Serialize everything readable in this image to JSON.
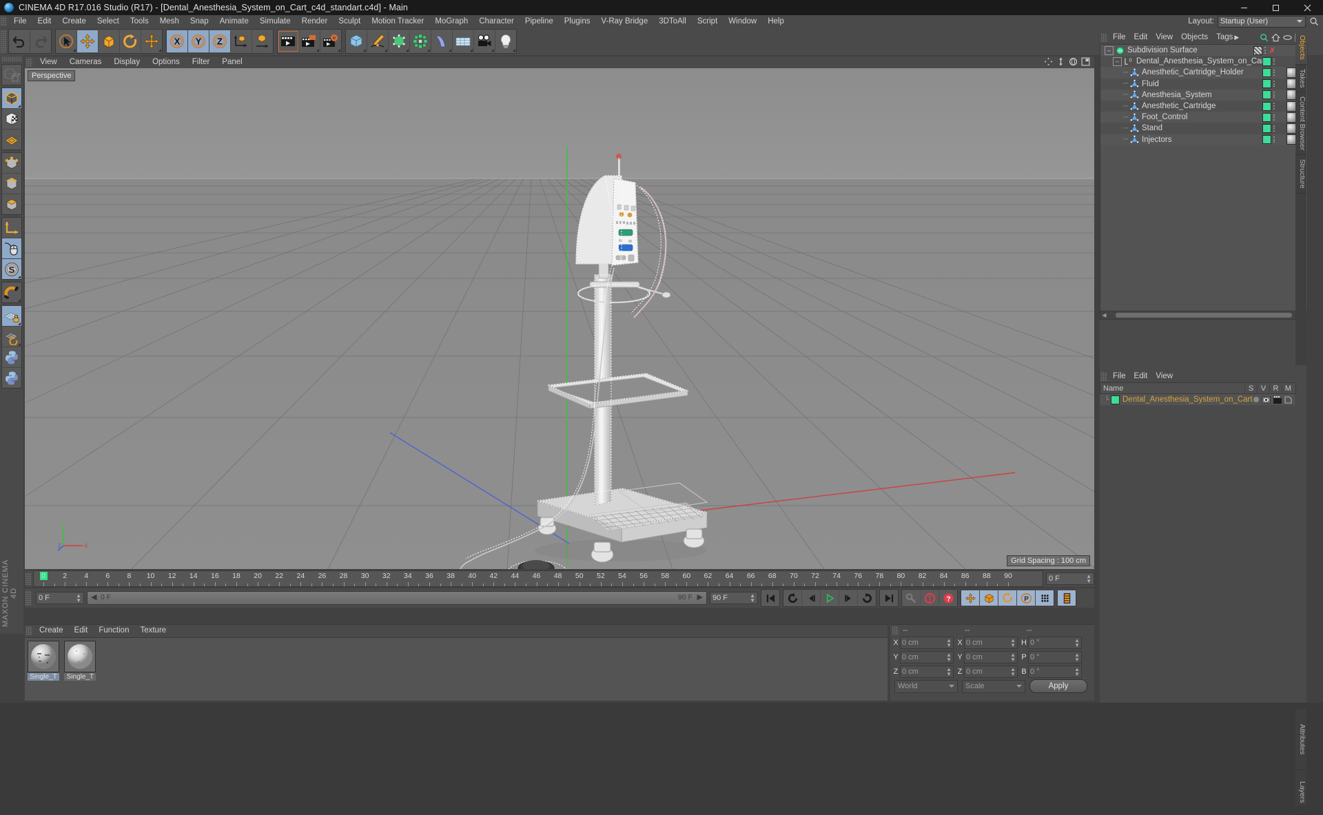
{
  "app": {
    "title": "CINEMA 4D R17.016 Studio (R17) - [Dental_Anesthesia_System_on_Cart_c4d_standart.c4d] - Main",
    "logo_icon": "cinema4d-logo-icon",
    "window_buttons": [
      "minimize",
      "maximize",
      "close"
    ]
  },
  "menubar": {
    "items": [
      "File",
      "Edit",
      "Create",
      "Select",
      "Tools",
      "Mesh",
      "Snap",
      "Animate",
      "Simulate",
      "Render",
      "Sculpt",
      "Motion Tracker",
      "MoGraph",
      "Character",
      "Pipeline",
      "Plugins",
      "V-Ray Bridge",
      "3DToAll",
      "Script",
      "Window",
      "Help"
    ],
    "layout_label": "Layout:",
    "layout_value": "Startup (User)",
    "search_icon": "search-icon"
  },
  "toolbar": {
    "groups": [
      {
        "buttons": [
          {
            "icon": "undo-icon",
            "active": false
          },
          {
            "icon": "redo-icon",
            "active": false
          }
        ]
      },
      {
        "buttons": [
          {
            "icon": "select-live-icon",
            "active": false,
            "corner": true
          },
          {
            "icon": "move-icon",
            "active": true
          },
          {
            "icon": "scale-icon",
            "active": false
          },
          {
            "icon": "rotate-icon",
            "active": false
          },
          {
            "icon": "move-duplicate-icon",
            "active": false,
            "corner": true
          }
        ]
      },
      {
        "buttons": [
          {
            "icon": "axis-x-icon",
            "active": true
          },
          {
            "icon": "axis-y-icon",
            "active": true
          },
          {
            "icon": "axis-z-icon",
            "active": true
          },
          {
            "icon": "world-object-axis-icon",
            "active": false
          },
          {
            "icon": "object-axis-icon",
            "active": false
          }
        ]
      },
      {
        "buttons": [
          {
            "icon": "render-view-icon",
            "active": false
          },
          {
            "icon": "render-region-icon",
            "active": false,
            "corner": true
          },
          {
            "icon": "render-settings-icon",
            "active": false,
            "corner": true
          }
        ]
      },
      {
        "buttons": [
          {
            "icon": "cube-primitive-icon",
            "active": false,
            "corner": true
          },
          {
            "icon": "spline-pen-icon",
            "active": false,
            "corner": true
          },
          {
            "icon": "generator-nurbs-icon",
            "active": false,
            "corner": true
          },
          {
            "icon": "mograph-array-icon",
            "active": false,
            "corner": true
          },
          {
            "icon": "deformer-bend-icon",
            "active": false,
            "corner": true
          },
          {
            "icon": "scene-floor-icon",
            "active": false,
            "corner": true
          },
          {
            "icon": "camera-icon",
            "active": false,
            "corner": true
          },
          {
            "icon": "light-icon",
            "active": false,
            "corner": true
          }
        ]
      }
    ]
  },
  "lefttoolbar": {
    "groups": [
      {
        "buttons": [
          {
            "icon": "make-editable-icon",
            "active": false
          }
        ]
      },
      {
        "buttons": [
          {
            "icon": "model-mode-icon",
            "active": true,
            "corner": true
          },
          {
            "icon": "texture-mode-icon",
            "active": false
          },
          {
            "icon": "polygon-grid-icon",
            "active": false
          }
        ]
      },
      {
        "buttons": [
          {
            "icon": "points-mode-icon",
            "active": false
          },
          {
            "icon": "edges-mode-icon",
            "active": false
          },
          {
            "icon": "polygons-mode-icon",
            "active": false
          }
        ]
      },
      {
        "buttons": [
          {
            "icon": "axis-modify-icon",
            "active": false
          },
          {
            "icon": "viewport-solo-mouse-icon",
            "active": true
          },
          {
            "icon": "enable-axis-s-icon",
            "active": true,
            "corner": true
          }
        ]
      },
      {
        "buttons": [
          {
            "icon": "magnet-icon",
            "active": false,
            "corner": true
          }
        ]
      },
      {
        "buttons": [
          {
            "icon": "lock-workplane-icon",
            "active": true,
            "corner": true
          },
          {
            "icon": "workplane-rotate-icon",
            "active": false,
            "corner": true
          },
          {
            "icon": "python-script-icon",
            "active": false
          },
          {
            "icon": "python-generator-icon",
            "active": false
          }
        ]
      }
    ],
    "brand": "MAXON CINEMA 4D"
  },
  "viewport": {
    "menu": [
      "View",
      "Cameras",
      "Display",
      "Options",
      "Filter",
      "Panel"
    ],
    "camera_tab": "Perspective",
    "grid_spacing": "Grid Spacing : 100 cm",
    "nav_icons": [
      "pan-icon",
      "dolly-icon",
      "orbit-icon",
      "maximize-viewport-icon"
    ],
    "axis_labels": {
      "x": "X",
      "y": "Y",
      "z": "Z"
    }
  },
  "timeline": {
    "ticks": [
      0,
      2,
      4,
      6,
      8,
      10,
      12,
      14,
      16,
      18,
      20,
      22,
      24,
      26,
      28,
      30,
      32,
      34,
      36,
      38,
      40,
      42,
      44,
      46,
      48,
      50,
      52,
      54,
      56,
      58,
      60,
      62,
      64,
      66,
      68,
      70,
      72,
      74,
      76,
      78,
      80,
      82,
      84,
      86,
      88,
      90
    ],
    "current_frame_display": "0 F",
    "start_field": "0 F",
    "preview_start": "0 F",
    "preview_end": "90 F",
    "end_field": "90 F",
    "min_frame": 0,
    "max_frame": 90,
    "playhead_frame": 0,
    "transport": [
      {
        "icon": "go-to-start-icon"
      },
      {
        "icon": "play-backwards-reverse-icon"
      },
      {
        "icon": "previous-frame-icon"
      },
      {
        "icon": "play-icon",
        "active": true
      },
      {
        "icon": "next-frame-icon"
      },
      {
        "icon": "play-forward-loop-icon"
      },
      {
        "icon": "go-to-end-icon"
      }
    ],
    "record_group": [
      {
        "icon": "autokey-icon"
      },
      {
        "icon": "record-active-objects-icon"
      },
      {
        "icon": "keyframe-selection-icon"
      }
    ],
    "key_group": [
      {
        "icon": "position-key-icon",
        "active": true
      },
      {
        "icon": "scale-key-icon",
        "active": true
      },
      {
        "icon": "rotation-key-icon",
        "active": true
      },
      {
        "icon": "param-key-icon",
        "active": true
      },
      {
        "icon": "pla-key-icon",
        "active": true
      }
    ],
    "timeline_toggle": {
      "icon": "timeline-icon",
      "active": true
    }
  },
  "material_manager": {
    "menu": [
      "Create",
      "Edit",
      "Function",
      "Texture"
    ],
    "materials": [
      {
        "name": "Single_T",
        "selected": true
      },
      {
        "name": "Single_T",
        "selected": false
      }
    ]
  },
  "coordinates": {
    "header": [
      "--",
      "--",
      "--"
    ],
    "rows": [
      {
        "l1": "X",
        "v1": "0 cm",
        "l2": "X",
        "v2": "0 cm",
        "l3": "H",
        "v3": "0 °"
      },
      {
        "l1": "Y",
        "v1": "0 cm",
        "l2": "Y",
        "v2": "0 cm",
        "l3": "P",
        "v3": "0 °"
      },
      {
        "l1": "Z",
        "v1": "0 cm",
        "l2": "Z",
        "v2": "0 cm",
        "l3": "B",
        "v3": "0 °"
      }
    ],
    "space_select": "World",
    "mode_select": "Scale",
    "apply_label": "Apply"
  },
  "object_manager": {
    "menu": [
      "File",
      "Edit",
      "View",
      "Objects",
      "Tags"
    ],
    "menu_more_icon": "chevron-right-icon",
    "icons": [
      "search-icon",
      "home-icon",
      "ellipse-icon",
      "add-layer-icon"
    ],
    "tree": [
      {
        "name": "Subdivision Surface",
        "depth": 0,
        "icon": "subdivision-surface-icon",
        "tag": "checker",
        "x": true,
        "material": false
      },
      {
        "name": "Dental_Anesthesia_System_on_Cart",
        "depth": 1,
        "icon": "null-layer-icon",
        "tag": "green",
        "material": false
      },
      {
        "name": "Anesthetic_Cartridge_Holder",
        "depth": 2,
        "icon": "polygon-object-icon",
        "tag": "green",
        "material": true
      },
      {
        "name": "Fluid",
        "depth": 2,
        "icon": "polygon-object-icon",
        "tag": "green",
        "material": true
      },
      {
        "name": "Anesthesia_System",
        "depth": 2,
        "icon": "polygon-object-icon",
        "tag": "green",
        "material": true
      },
      {
        "name": "Anesthetic_Cartridge",
        "depth": 2,
        "icon": "polygon-object-icon",
        "tag": "green",
        "material": true
      },
      {
        "name": "Foot_Control",
        "depth": 2,
        "icon": "polygon-object-icon",
        "tag": "green",
        "material": true
      },
      {
        "name": "Stand",
        "depth": 2,
        "icon": "polygon-object-icon",
        "tag": "green",
        "material": true
      },
      {
        "name": "Injectors",
        "depth": 2,
        "icon": "polygon-object-icon",
        "tag": "green",
        "material": true
      }
    ],
    "side_tabs": [
      "Objects",
      "Takes",
      "Content Browser",
      "Structure"
    ],
    "active_side_tab": "Objects"
  },
  "layer_manager": {
    "menu": [
      "File",
      "Edit",
      "View"
    ],
    "column_name": "Name",
    "columns": [
      "S",
      "V",
      "R",
      "M"
    ],
    "rows": [
      {
        "name": "Dental_Anesthesia_System_on_Cart",
        "color": "#3ddc97"
      }
    ],
    "side_tabs": [
      "Attributes",
      "Layers"
    ]
  },
  "colors": {
    "accent_green": "#3ddc97",
    "accent_orange": "#e8a93a",
    "toolbar_bg": "#4a4a4a",
    "panel_bg": "#535353",
    "titlebar_bg": "#1a1a1a",
    "viewport_sky": "#8e8e8e",
    "viewport_ground": "#8b8b8b",
    "axis_x": "#c2504b",
    "axis_y": "#5fbf4a",
    "axis_z": "#4b6fc2"
  }
}
